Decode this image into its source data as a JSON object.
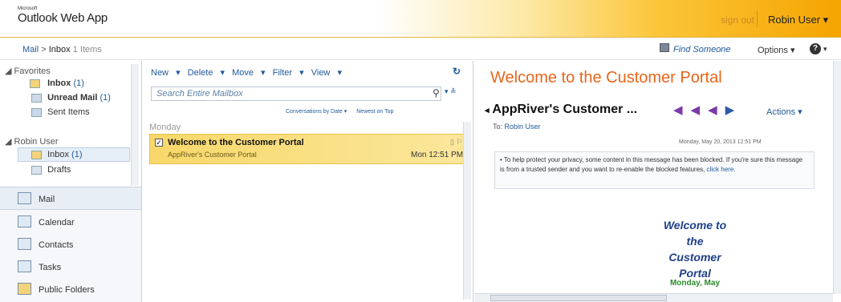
{
  "app": {
    "brand_small": "Microsoft",
    "title": "Outlook Web App"
  },
  "header": {
    "sign_out": "sign out",
    "user": "Robin User"
  },
  "breadcrumb": {
    "mail": "Mail",
    "arrow": ">",
    "folder": "Inbox",
    "count": "1 Items"
  },
  "toolbar_right": {
    "find": "Find Someone",
    "options": "Options",
    "help": "?"
  },
  "favorites": {
    "header": "Favorites",
    "items": [
      {
        "label": "Inbox",
        "count": "(1)"
      },
      {
        "label": "Unread Mail",
        "count": "(1)"
      },
      {
        "label": "Sent Items",
        "count": ""
      }
    ]
  },
  "mailbox": {
    "header": "Robin User",
    "items": [
      {
        "label": "Inbox",
        "count": "(1)"
      },
      {
        "label": "Drafts",
        "count": ""
      }
    ]
  },
  "modules": [
    {
      "label": "Mail",
      "icon": "mail-icon"
    },
    {
      "label": "Calendar",
      "icon": "calendar-icon"
    },
    {
      "label": "Contacts",
      "icon": "contacts-icon"
    },
    {
      "label": "Tasks",
      "icon": "tasks-icon"
    },
    {
      "label": "Public Folders",
      "icon": "public-folders-icon"
    }
  ],
  "list_toolbar": {
    "new": "New",
    "delete": "Delete",
    "move": "Move",
    "filter": "Filter",
    "view": "View"
  },
  "search": {
    "placeholder": "Search Entire Mailbox"
  },
  "sort": {
    "by": "Conversations by Date",
    "order": "Newest on Top"
  },
  "group_header": "Monday",
  "messages": [
    {
      "subject": "Welcome to the Customer Portal",
      "from": "AppRiver's Customer Portal",
      "time": "Mon 12:51 PM"
    }
  ],
  "reading": {
    "title": "Welcome to the Customer Portal",
    "sender": "AppRiver's Customer ...",
    "actions": "Actions",
    "to_label": "To:",
    "to_name": "Robin User",
    "date": "Monday, May 20, 2013 12:51 PM",
    "notice": "To help protect your privacy, some content in this message has been blocked. If you're sure this message is from a trusted sender and you want to re-enable the blocked features,",
    "notice_link": "click here.",
    "body_lines": [
      "Welcome to",
      "the",
      "Customer",
      "Portal"
    ],
    "body_date": "Monday, May"
  },
  "colors": {
    "accent": "#e8651a",
    "link": "#1f5a9a",
    "selected_row": "#f8d86a"
  }
}
